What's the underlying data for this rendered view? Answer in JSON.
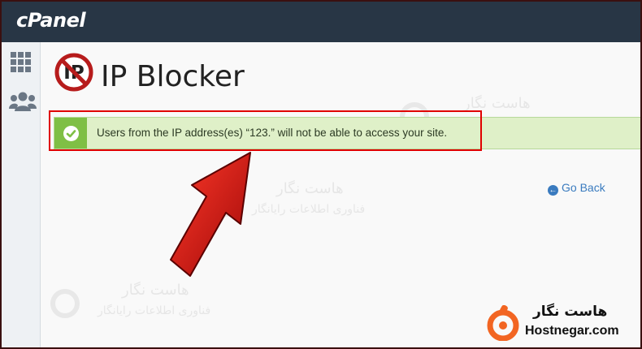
{
  "app": {
    "brand": "cPanel"
  },
  "sidebar": {
    "items": [
      {
        "icon": "grid-icon"
      },
      {
        "icon": "users-icon"
      }
    ]
  },
  "page": {
    "title": "IP Blocker",
    "title_icon": "ip-blocked-icon"
  },
  "alert": {
    "type": "success",
    "message": "Users from the IP address(es) “123.” will not be able to access your site."
  },
  "actions": {
    "go_back": "Go Back"
  },
  "watermark": {
    "name_fa": "هاست نگار",
    "tagline_fa": "فناوری اطلاعات رایانگار"
  },
  "branding": {
    "name_fa": "هاست نگار",
    "site": "Hostnegar.com"
  },
  "colors": {
    "topbar": "#283645",
    "success_bg": "#dff0c8",
    "success_accent": "#7fbf45",
    "highlight": "#e00000",
    "link": "#3a7bbf",
    "arrow": "#d41414",
    "brand_orange": "#f26522"
  }
}
